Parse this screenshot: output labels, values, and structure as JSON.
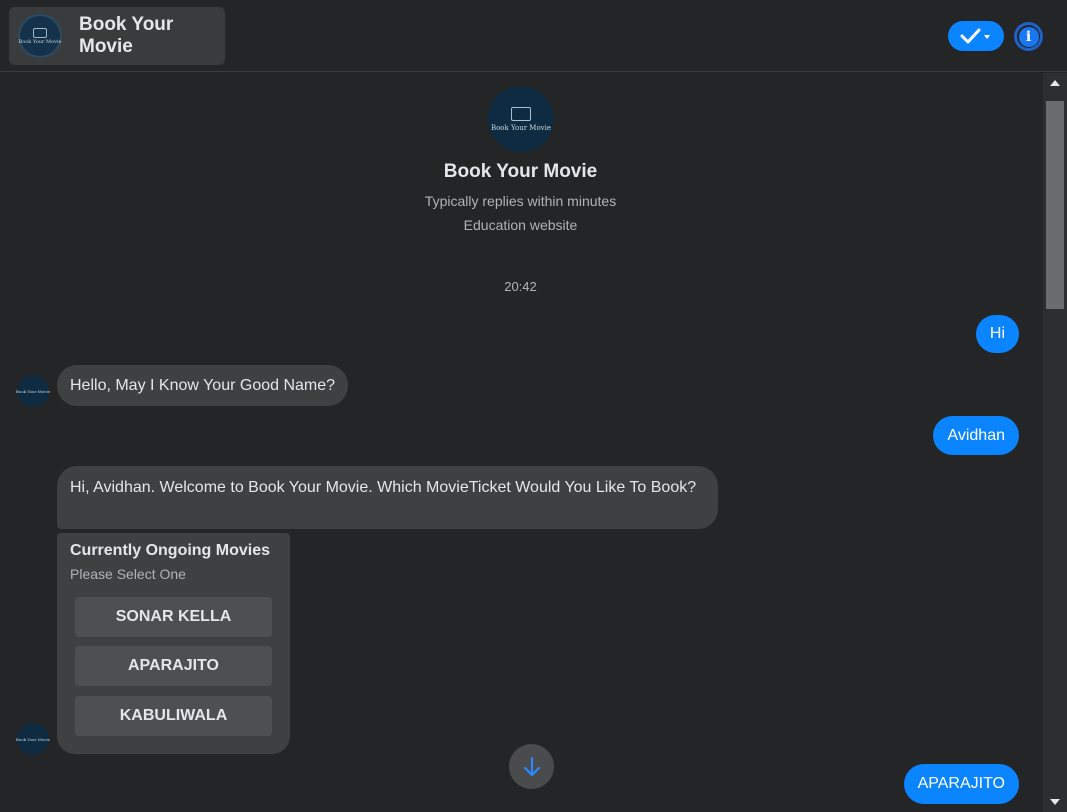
{
  "header": {
    "title": "Book Your Movie",
    "logo_text": "Book Your Movie",
    "status_icon": "check-icon",
    "info_icon": "info-icon"
  },
  "profile": {
    "name": "Book Your Movie",
    "logo_text": "Book Your Movie",
    "replies": "Typically replies within minutes",
    "category": "Education website"
  },
  "timestamp": "20:42",
  "messages": [
    {
      "from": "user",
      "text": "Hi"
    },
    {
      "from": "bot",
      "text": "Hello, May I Know Your Good Name?"
    },
    {
      "from": "user",
      "text": "Avidhan"
    },
    {
      "from": "bot",
      "text": "Hi, Avidhan. Welcome to Book Your Movie. Which MovieTicket Would You Like To Book?"
    },
    {
      "from": "user",
      "text": "APARAJITO"
    }
  ],
  "card": {
    "title": "Currently Ongoing Movies",
    "subtitle": "Please Select One",
    "options": [
      "SONAR KELLA",
      "APARAJITO",
      "KABULIWALA"
    ]
  },
  "avatar_text": "Book Your Movie",
  "colors": {
    "accent": "#0a84ff",
    "background": "#242526",
    "bubble_in": "#3e4042"
  }
}
